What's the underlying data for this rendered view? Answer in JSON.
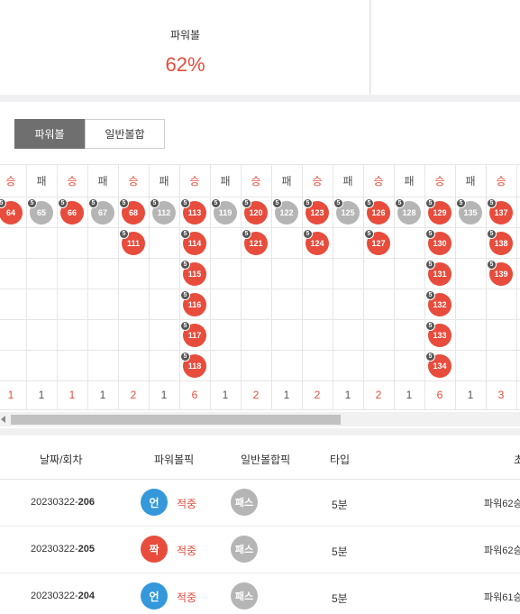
{
  "stat": {
    "label": "파워볼",
    "value": "62%"
  },
  "tabs": {
    "active": "파워볼",
    "inactive": "일반볼합"
  },
  "grid": {
    "columns": [
      {
        "result": "승",
        "badge": "5",
        "balls": [
          "64"
        ],
        "count": "1"
      },
      {
        "result": "패",
        "badge": "5",
        "balls": [
          "65"
        ],
        "count": "1"
      },
      {
        "result": "승",
        "badge": "5",
        "balls": [
          "66"
        ],
        "count": "1"
      },
      {
        "result": "패",
        "badge": "5",
        "balls": [
          "67"
        ],
        "count": "1"
      },
      {
        "result": "승",
        "badge": "5",
        "balls": [
          "68",
          "111"
        ],
        "count": "2"
      },
      {
        "result": "패",
        "badge": "5",
        "balls": [
          "112"
        ],
        "count": "1"
      },
      {
        "result": "승",
        "badge": "5",
        "balls": [
          "113",
          "114",
          "115",
          "116",
          "117",
          "118"
        ],
        "count": "6"
      },
      {
        "result": "패",
        "badge": "5",
        "balls": [
          "119"
        ],
        "count": "1"
      },
      {
        "result": "승",
        "badge": "5",
        "balls": [
          "120",
          "121"
        ],
        "count": "2"
      },
      {
        "result": "패",
        "badge": "5",
        "balls": [
          "122"
        ],
        "count": "1"
      },
      {
        "result": "승",
        "badge": "5",
        "balls": [
          "123",
          "124"
        ],
        "count": "2"
      },
      {
        "result": "패",
        "badge": "5",
        "balls": [
          "125"
        ],
        "count": "1"
      },
      {
        "result": "승",
        "badge": "5",
        "balls": [
          "126",
          "127"
        ],
        "count": "2"
      },
      {
        "result": "패",
        "badge": "5",
        "balls": [
          "128"
        ],
        "count": "1"
      },
      {
        "result": "승",
        "badge": "5",
        "balls": [
          "129",
          "130",
          "131",
          "132",
          "133",
          "134"
        ],
        "count": "6"
      },
      {
        "result": "패",
        "badge": "5",
        "balls": [
          "135"
        ],
        "count": "1"
      },
      {
        "result": "승",
        "badge": "5",
        "balls": [
          "137",
          "138",
          "139"
        ],
        "count": "3"
      }
    ]
  },
  "table": {
    "headers": {
      "date": "날짜/회차",
      "powerball_pick": "파워볼픽",
      "normal_pick": "일반볼합픽",
      "type": "타입",
      "extra": "초"
    },
    "rows": [
      {
        "date": "20230322-",
        "round": "206",
        "pick": "언",
        "pick_color": "blue",
        "hit": "적중",
        "normal": "패스",
        "type": "5분",
        "extra": "파워62승"
      },
      {
        "date": "20230322-",
        "round": "205",
        "pick": "짝",
        "pick_color": "red",
        "hit": "적중",
        "normal": "패스",
        "type": "5분",
        "extra": "파워62승"
      },
      {
        "date": "20230322-",
        "round": "204",
        "pick": "언",
        "pick_color": "blue",
        "hit": "적중",
        "normal": "패스",
        "type": "5분",
        "extra": "파워61승"
      }
    ]
  }
}
